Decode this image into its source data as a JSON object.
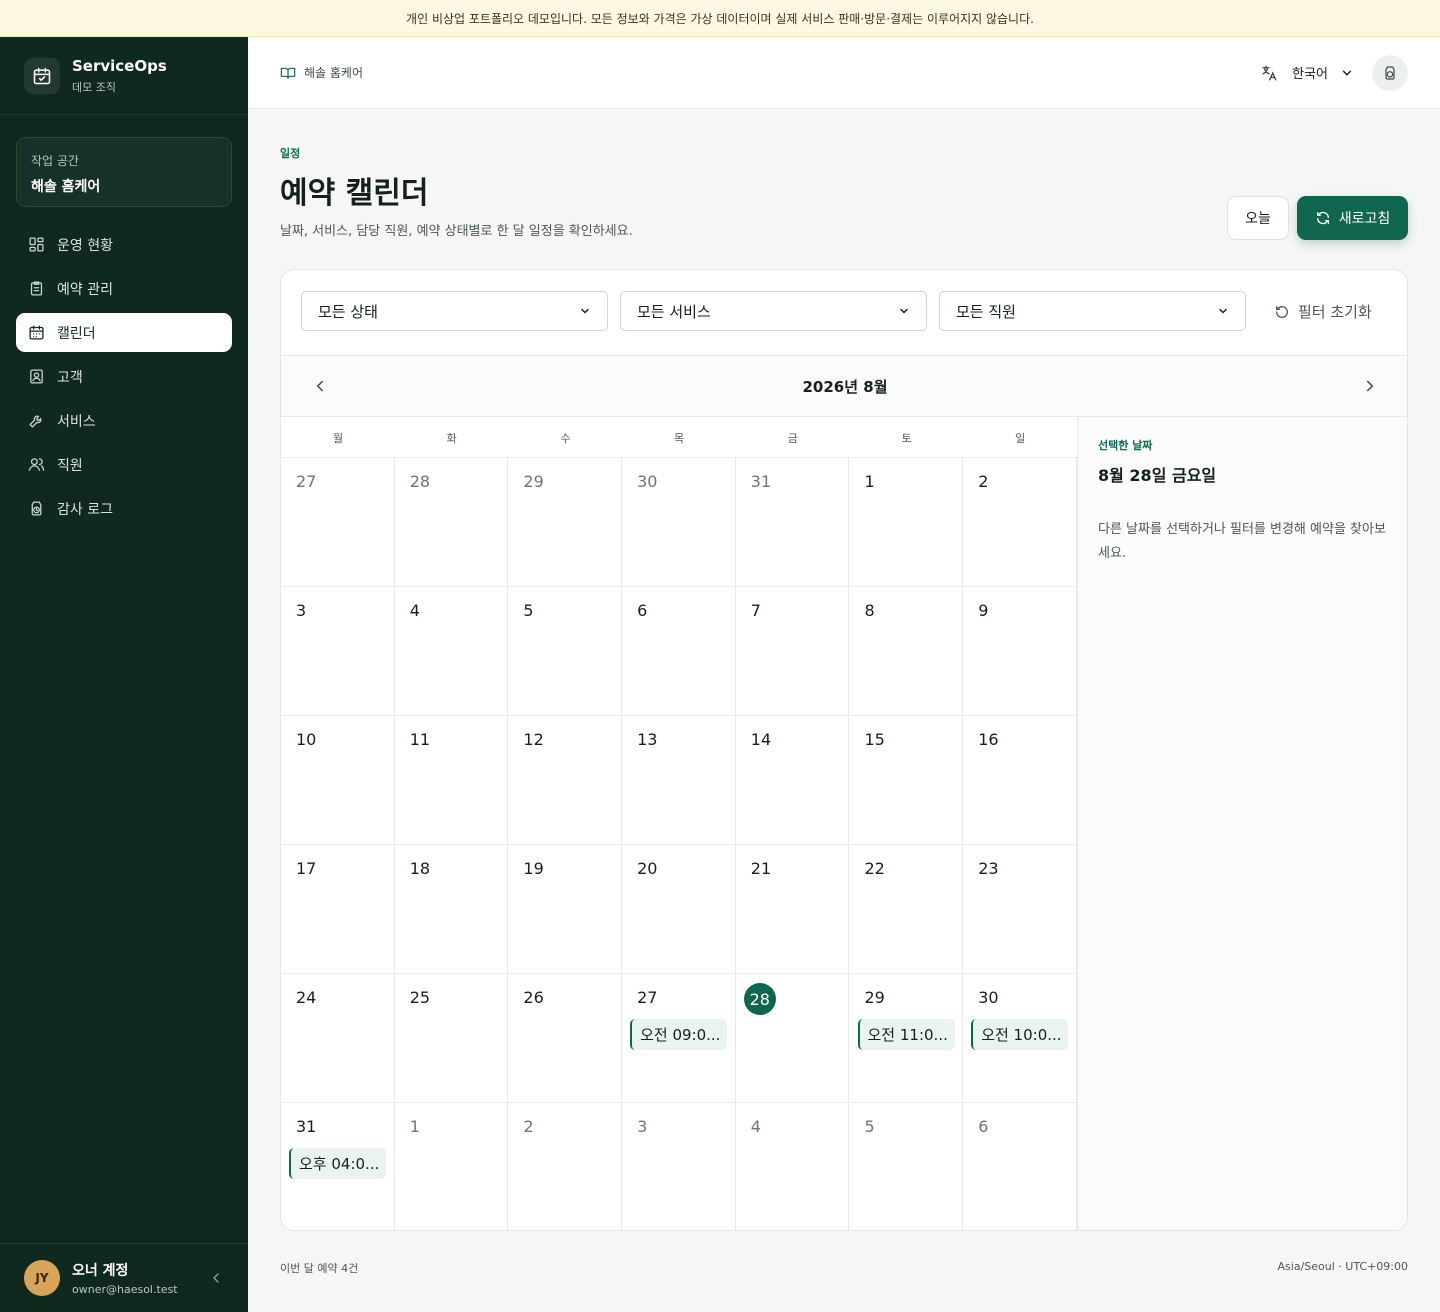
{
  "banner": "개인 비상업 포트폴리오 데모입니다. 모든 정보와 가격은 가상 데이터이며 실제 서비스 판매·방문·결제는 이루어지지 않습니다.",
  "brand": {
    "name": "ServiceOps",
    "org": "데모 조직"
  },
  "workspace": {
    "label": "작업 공간",
    "name": "해솔 홈케어"
  },
  "nav": [
    {
      "label": "운영 현황",
      "icon": "dashboard-icon"
    },
    {
      "label": "예약 관리",
      "icon": "clipboard-icon"
    },
    {
      "label": "캘린더",
      "icon": "calendar-icon",
      "active": true
    },
    {
      "label": "고객",
      "icon": "contact-icon"
    },
    {
      "label": "서비스",
      "icon": "wrench-icon"
    },
    {
      "label": "직원",
      "icon": "users-icon"
    },
    {
      "label": "감사 로그",
      "icon": "history-icon"
    }
  ],
  "user": {
    "initials": "JY",
    "name": "오너 계정",
    "email": "owner@haesol.test"
  },
  "topbar": {
    "breadcrumb": "해솔 홈케어",
    "language": "한국어"
  },
  "header": {
    "eyebrow": "일정",
    "title": "예약 캘린더",
    "subtitle": "날짜, 서비스, 담당 직원, 예약 상태별로 한 달 일정을 확인하세요.",
    "today_label": "오늘",
    "refresh_label": "새로고침"
  },
  "filters": {
    "status": "모든 상태",
    "service": "모든 서비스",
    "staff": "모든 직원",
    "reset_label": "필터 초기화"
  },
  "calendar": {
    "month_title": "2026년 8월",
    "weekdays": [
      "월",
      "화",
      "수",
      "목",
      "금",
      "토",
      "일"
    ],
    "weeks": [
      [
        {
          "d": "27",
          "other": true
        },
        {
          "d": "28",
          "other": true
        },
        {
          "d": "29",
          "other": true
        },
        {
          "d": "30",
          "other": true
        },
        {
          "d": "31",
          "other": true
        },
        {
          "d": "1"
        },
        {
          "d": "2"
        }
      ],
      [
        {
          "d": "3"
        },
        {
          "d": "4"
        },
        {
          "d": "5"
        },
        {
          "d": "6"
        },
        {
          "d": "7"
        },
        {
          "d": "8"
        },
        {
          "d": "9"
        }
      ],
      [
        {
          "d": "10"
        },
        {
          "d": "11"
        },
        {
          "d": "12"
        },
        {
          "d": "13"
        },
        {
          "d": "14"
        },
        {
          "d": "15"
        },
        {
          "d": "16"
        }
      ],
      [
        {
          "d": "17"
        },
        {
          "d": "18"
        },
        {
          "d": "19"
        },
        {
          "d": "20"
        },
        {
          "d": "21"
        },
        {
          "d": "22"
        },
        {
          "d": "23"
        }
      ],
      [
        {
          "d": "24"
        },
        {
          "d": "25"
        },
        {
          "d": "26"
        },
        {
          "d": "27",
          "event": "오전 09:0..."
        },
        {
          "d": "28",
          "selected": true
        },
        {
          "d": "29",
          "event": "오전 11:0..."
        },
        {
          "d": "30",
          "event": "오전 10:0..."
        }
      ],
      [
        {
          "d": "31",
          "event": "오후 04:0..."
        },
        {
          "d": "1",
          "other": true
        },
        {
          "d": "2",
          "other": true
        },
        {
          "d": "3",
          "other": true
        },
        {
          "d": "4",
          "other": true
        },
        {
          "d": "5",
          "other": true
        },
        {
          "d": "6",
          "other": true
        }
      ]
    ]
  },
  "side_panel": {
    "eyebrow": "선택한 날짜",
    "date": "8월 28일 금요일",
    "empty": "다른 날짜를 선택하거나 필터를 변경해 예약을 찾아보세요."
  },
  "footer": {
    "count": "이번 달 예약 4건",
    "timezone": "Asia/Seoul · UTC+09:00"
  },
  "colors": {
    "sidebar": "#10291f",
    "accent": "#11664f",
    "banner": "#fdf8e4"
  }
}
